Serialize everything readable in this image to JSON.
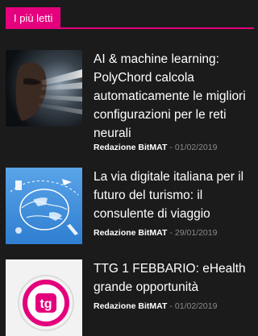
{
  "colors": {
    "accent": "#e5007d",
    "background": "#1b1b1b",
    "meta_text": "#8a8a8a"
  },
  "widget": {
    "title": "I più letti"
  },
  "posts": [
    {
      "title": "AI & machine learning: PolyChord calcola automaticamente le migliori configurazioni per le reti neurali",
      "author": "Redazione BitMAT",
      "separator": "-",
      "date": "01/02/2019",
      "thumb_icon": "ai-face-image"
    },
    {
      "title": "La via digitale italiana per il futuro del turismo: il consulente di viaggio",
      "author": "Redazione BitMAT",
      "separator": "-",
      "date": "29/01/2019",
      "thumb_icon": "globe-travel-image"
    },
    {
      "title": "TTG 1 FEBBARIO: eHealth grande opportunità",
      "author": "Redazione BitMAT",
      "separator": "-",
      "date": "01/02/2019",
      "thumb_icon": "ttg-logo-image",
      "logo_text": "tg"
    }
  ]
}
